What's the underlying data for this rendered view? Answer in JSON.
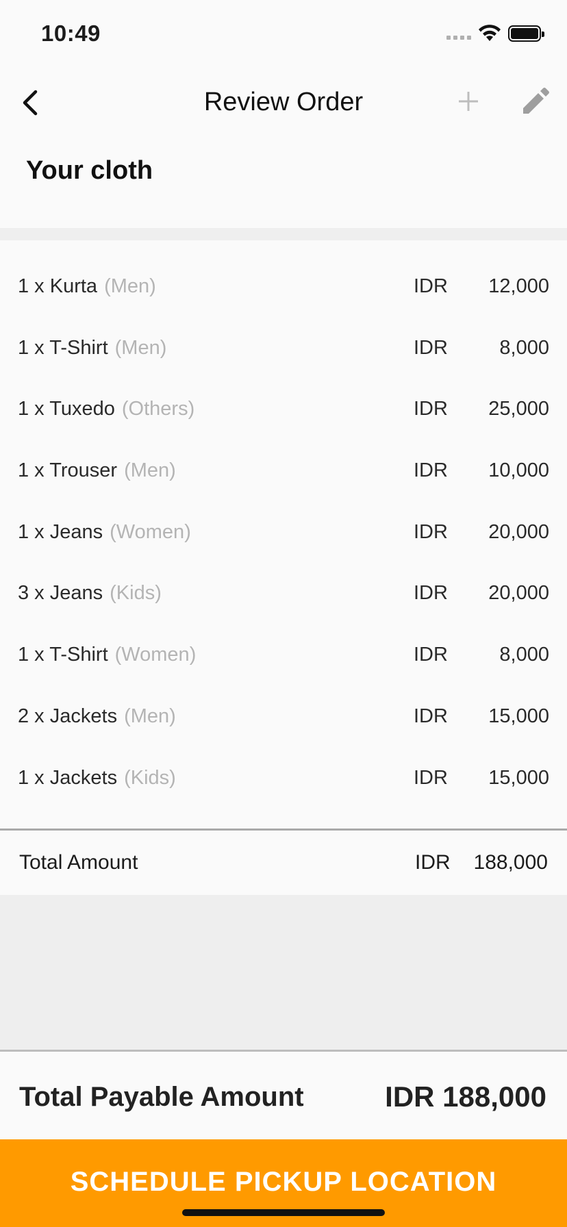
{
  "status_bar": {
    "time": "10:49"
  },
  "nav": {
    "title": "Review Order"
  },
  "section": {
    "title": "Your cloth"
  },
  "items": [
    {
      "qty": "1 x",
      "name": "Kurta",
      "category": "(Men)",
      "currency": "IDR",
      "price": "12,000"
    },
    {
      "qty": "1 x",
      "name": "T-Shirt",
      "category": "(Men)",
      "currency": "IDR",
      "price": "8,000"
    },
    {
      "qty": "1 x",
      "name": "Tuxedo",
      "category": "(Others)",
      "currency": "IDR",
      "price": "25,000"
    },
    {
      "qty": "1 x",
      "name": "Trouser",
      "category": "(Men)",
      "currency": "IDR",
      "price": "10,000"
    },
    {
      "qty": "1 x",
      "name": "Jeans",
      "category": "(Women)",
      "currency": "IDR",
      "price": "20,000"
    },
    {
      "qty": "3 x",
      "name": "Jeans",
      "category": "(Kids)",
      "currency": "IDR",
      "price": "20,000"
    },
    {
      "qty": "1 x",
      "name": "T-Shirt",
      "category": "(Women)",
      "currency": "IDR",
      "price": "8,000"
    },
    {
      "qty": "2 x",
      "name": "Jackets",
      "category": "(Men)",
      "currency": "IDR",
      "price": "15,000"
    },
    {
      "qty": "1 x",
      "name": "Jackets",
      "category": "(Kids)",
      "currency": "IDR",
      "price": "15,000"
    }
  ],
  "total": {
    "label": "Total Amount",
    "currency": "IDR",
    "value": "188,000"
  },
  "payable": {
    "label": "Total Payable Amount",
    "value": "IDR 188,000"
  },
  "cta": {
    "label": "SCHEDULE PICKUP LOCATION",
    "color": "#ff9a00"
  },
  "icons": [
    "back-arrow-icon",
    "plus-icon",
    "pencil-icon",
    "signal-icon",
    "wifi-icon",
    "battery-icon"
  ]
}
